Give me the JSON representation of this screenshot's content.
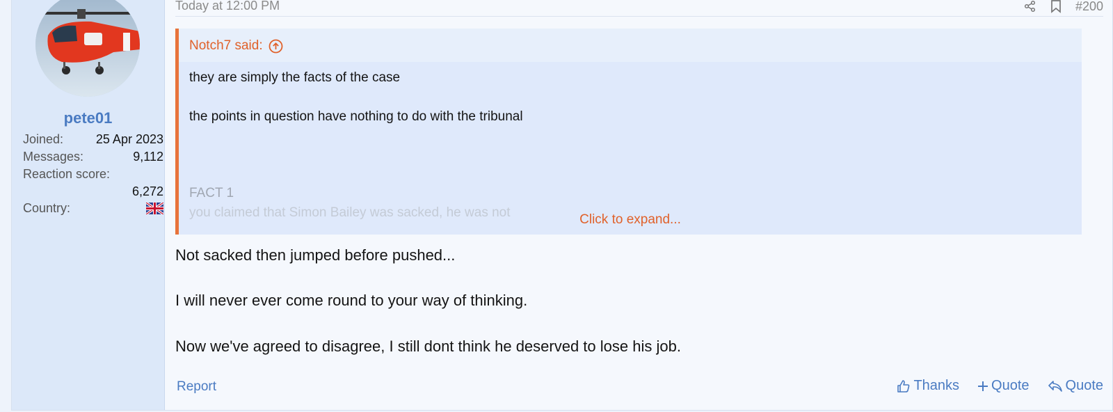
{
  "user": {
    "username": "pete01",
    "stats": [
      {
        "label": "Joined:",
        "value": "25 Apr 2023"
      },
      {
        "label": "Messages:",
        "value": "9,112"
      },
      {
        "label": "Reaction score:",
        "value": "6,272"
      },
      {
        "label": "Country:",
        "value": ""
      }
    ],
    "avatar_icon": "helicopter-avatar",
    "flag_icon": "uk-flag-icon"
  },
  "post": {
    "date": "Today at 12:00 PM",
    "number": "#200",
    "header_icons": [
      "share-icon",
      "bookmark-icon"
    ]
  },
  "quote": {
    "title": "Notch7 said:",
    "lines": [
      "they are simply the facts of the case",
      "the points in question have nothing to do with the tribunal",
      "FACT 1",
      "you claimed that Simon Bailey was sacked, he was not"
    ],
    "expand_label": "Click to expand..."
  },
  "body": {
    "lines": [
      "Not sacked then jumped before pushed...",
      "I will never ever come round to your way of thinking.",
      "Now we've agreed to disagree, I still dont think he deserved to lose his job."
    ]
  },
  "footer": {
    "report_label": "Report",
    "actions": [
      {
        "icon": "thumbs-up-icon",
        "label": "Thanks"
      },
      {
        "icon": "plus-icon",
        "label": "Quote"
      },
      {
        "icon": "reply-icon",
        "label": "Quote"
      }
    ]
  },
  "colors": {
    "accent": "#4a7bc2",
    "quote_accent": "#e0612a",
    "user_bg": "#dce8f9",
    "quote_bg": "#dfe9fb"
  }
}
